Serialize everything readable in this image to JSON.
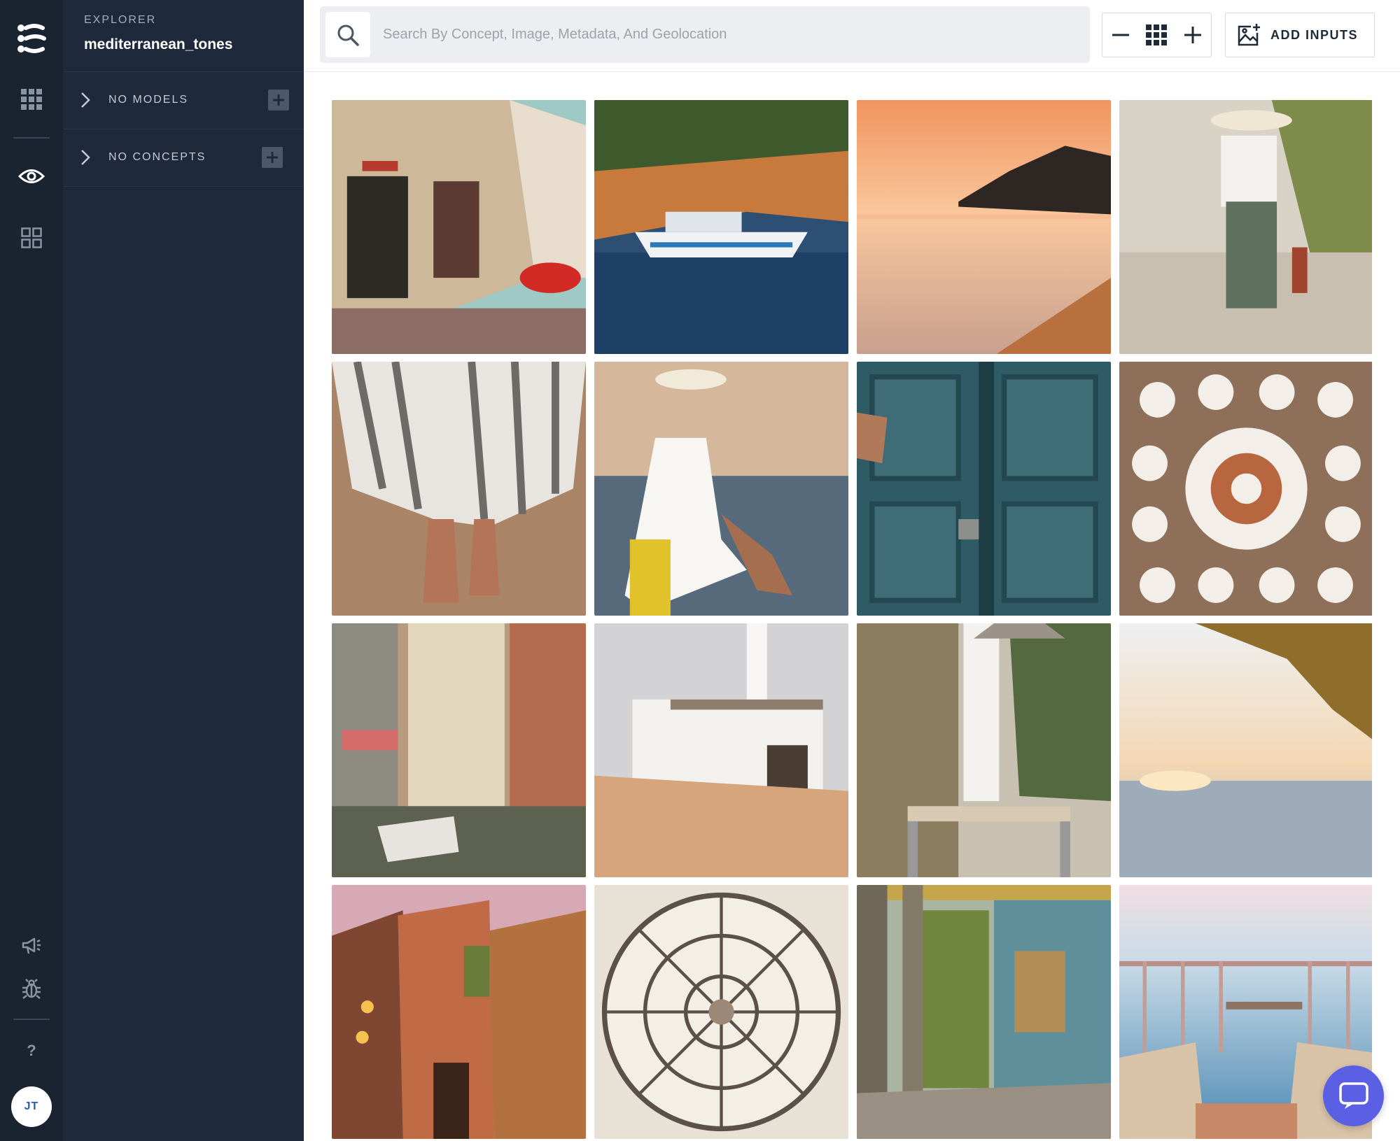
{
  "sidebar": {
    "nav_icons": [
      "clarifai-logo-icon",
      "apps-grid-icon",
      "eye-icon",
      "dashboard-icon",
      "megaphone-icon",
      "bug-icon",
      "help-icon"
    ],
    "help_label": "?",
    "avatar_initials": "JT"
  },
  "explorer": {
    "eyebrow": "EXPLORER",
    "app_name": "mediterranean_tones",
    "sections": [
      {
        "label": "NO MODELS"
      },
      {
        "label": "NO CONCEPTS"
      }
    ]
  },
  "toolbar": {
    "search_placeholder": "Search By Concept, Image, Metadata, And Geolocation",
    "add_inputs_label": "ADD INPUTS"
  },
  "gallery": {
    "images": [
      "storefront-street-with-red-car",
      "fishing-boat-by-rocky-cliff",
      "sunset-beach-shoreline",
      "woman-in-hat-walking-holding-sandals",
      "bare-feet-striped-pants-on-sand",
      "woman-in-white-dress-by-harbor",
      "weathered-blue-door-with-lock",
      "geometric-mosaic-pattern",
      "venice-canal-with-boat",
      "white-building-with-dry-grass",
      "patio-chairs-under-lamp",
      "sunset-over-sea-through-tree",
      "old-town-terracotta-buildings",
      "glass-dome-ceiling",
      "tiled-arcade-with-columns",
      "balcony-with-chairs-and-wine-by-sea"
    ]
  },
  "colors": {
    "rail": "#1a2330",
    "panel": "#1e2a3b",
    "accent": "#5b5fe3"
  }
}
